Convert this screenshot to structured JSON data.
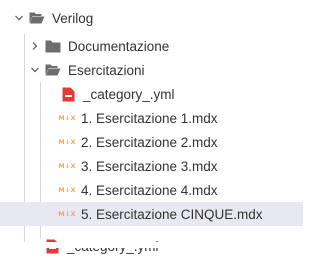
{
  "explorer": {
    "root": {
      "label": "Verilog",
      "icon": "folder-open-icon",
      "expanded": true
    },
    "folders": [
      {
        "label": "Documentazione",
        "icon": "folder-icon",
        "expanded": false
      },
      {
        "label": "Esercitazioni",
        "icon": "folder-open-icon",
        "expanded": true
      }
    ],
    "esercitazioni_children": [
      {
        "label": "_category_.yml",
        "icon": "yaml-file-icon"
      },
      {
        "label": "1. Esercitazione 1.mdx",
        "icon": "mdx-file-icon",
        "badge": "M↓X"
      },
      {
        "label": "2. Esercitazione 2.mdx",
        "icon": "mdx-file-icon",
        "badge": "M↓X"
      },
      {
        "label": "3. Esercitazione 3.mdx",
        "icon": "mdx-file-icon",
        "badge": "M↓X"
      },
      {
        "label": "4. Esercitazione 4.mdx",
        "icon": "mdx-file-icon",
        "badge": "M↓X"
      },
      {
        "label": "5. Esercitazione CINQUE.mdx",
        "icon": "mdx-file-icon",
        "badge": "M↓X",
        "selected": true
      }
    ],
    "trailing_item": {
      "label": "_category_.yml",
      "icon": "yaml-file-icon"
    }
  },
  "colors": {
    "folder": "#6d6d6d",
    "yaml_icon": "#e23a36",
    "mdx_badge": "#f0a85e",
    "selection": "#e8e8f2",
    "indent_guide": "#d6d6d6"
  }
}
